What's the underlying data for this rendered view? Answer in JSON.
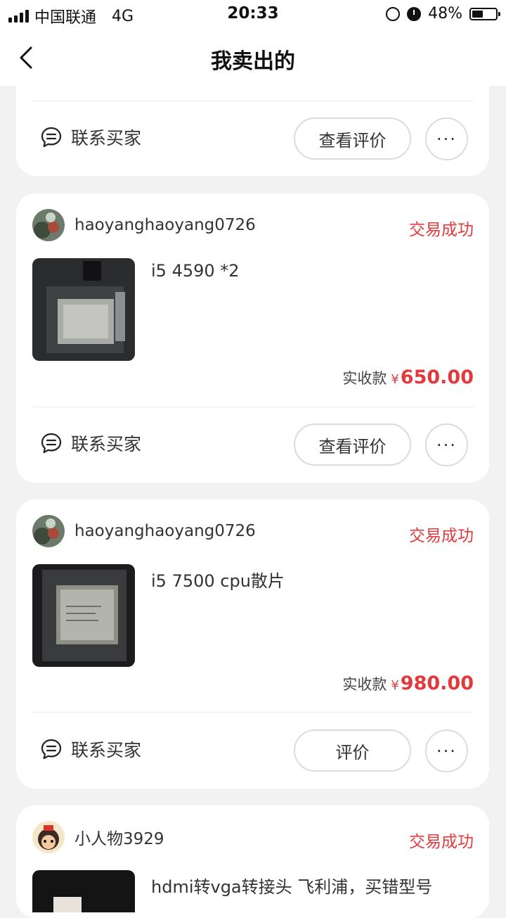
{
  "status_bar": {
    "carrier": "中国联通",
    "network": "4G",
    "time": "20:33",
    "battery": "48%",
    "battery_level": 0.48
  },
  "nav": {
    "title": "我卖出的",
    "back_icon": "chevron-left-icon"
  },
  "colors": {
    "accent": "#e4393c",
    "background": "#f2f2f2"
  },
  "common": {
    "contact_label": "联系买家",
    "more_label": "···",
    "price_label": "实收款",
    "currency": "¥"
  },
  "orders": [
    {
      "action_label": "查看评价"
    },
    {
      "buyer": "haoyanghaoyang0726",
      "status": "交易成功",
      "title": "i5 4590 *2",
      "price": "650.00",
      "action_label": "查看评价"
    },
    {
      "buyer": "haoyanghaoyang0726",
      "status": "交易成功",
      "title": "i5 7500 cpu散片",
      "price": "980.00",
      "action_label": "评价"
    },
    {
      "buyer": "小人物3929",
      "status": "交易成功",
      "title": "hdmi转vga转接头 飞利浦，买错型号"
    }
  ]
}
